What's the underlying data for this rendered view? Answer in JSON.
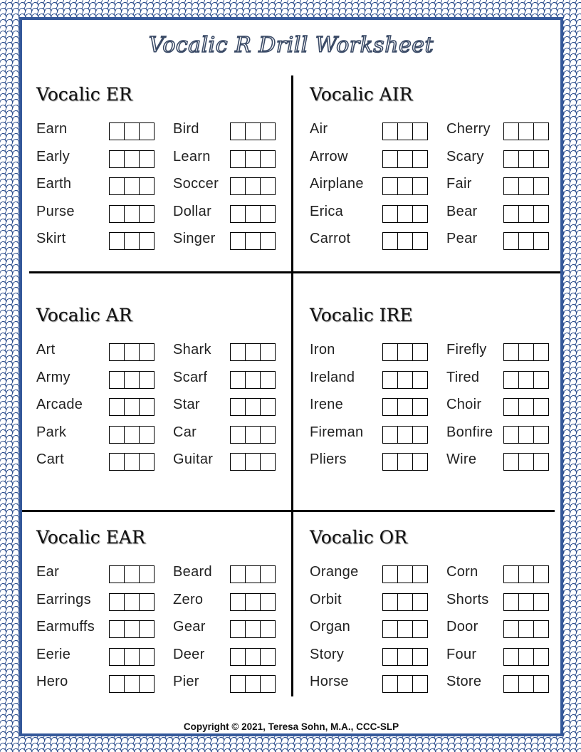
{
  "title": "Vocalic R Drill Worksheet",
  "copyright": "Copyright © 2021, Teresa Sohn, M.A., CCC-SLP",
  "sections": [
    {
      "title": "Vocalic ER",
      "left": [
        "Earn",
        "Early",
        "Earth",
        "Purse",
        "Skirt"
      ],
      "right": [
        "Bird",
        "Learn",
        "Soccer",
        "Dollar",
        "Singer"
      ]
    },
    {
      "title": "Vocalic AIR",
      "left": [
        "Air",
        "Arrow",
        "Airplane",
        "Erica",
        "Carrot"
      ],
      "right": [
        "Cherry",
        "Scary",
        "Fair",
        "Bear",
        "Pear"
      ]
    },
    {
      "title": "Vocalic AR",
      "left": [
        "Art",
        "Army",
        "Arcade",
        "Park",
        "Cart"
      ],
      "right": [
        "Shark",
        "Scarf",
        "Star",
        "Car",
        "Guitar"
      ]
    },
    {
      "title": "Vocalic IRE",
      "left": [
        "Iron",
        "Ireland",
        "Irene",
        "Fireman",
        "Pliers"
      ],
      "right": [
        "Firefly",
        "Tired",
        "Choir",
        "Bonfire",
        "Wire"
      ]
    },
    {
      "title": "Vocalic EAR",
      "left": [
        "Ear",
        "Earrings",
        "Earmuffs",
        "Eerie",
        "Hero"
      ],
      "right": [
        "Beard",
        "Zero",
        "Gear",
        "Deer",
        "Pier"
      ]
    },
    {
      "title": "Vocalic OR",
      "left": [
        "Orange",
        "Orbit",
        "Organ",
        "Story",
        "Horse"
      ],
      "right": [
        "Corn",
        "Shorts",
        "Door",
        "Four",
        "Store"
      ]
    }
  ],
  "boxes_per_word": 3,
  "colors": {
    "border": "#34589a",
    "pattern": "#2d4f8e"
  }
}
